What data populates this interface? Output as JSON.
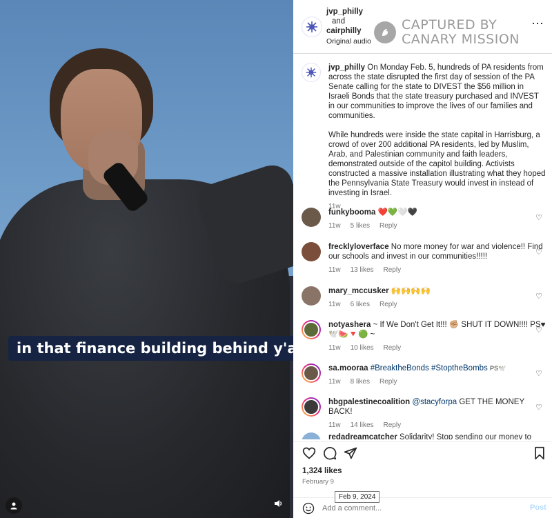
{
  "video": {
    "caption": "in that finance building behind y'all",
    "account_icon": "person-icon",
    "audio_icon": "speaker-icon"
  },
  "header": {
    "user1": "jvp_philly",
    "and": "and",
    "user2": "cairphilly",
    "audio": "Original audio",
    "watermark_line1": "CAPTURED BY",
    "watermark_line2": "CANARY MISSION",
    "more": "⋯"
  },
  "post": {
    "user": "jvp_philly",
    "text1": "On Monday Feb. 5, hundreds of PA residents from across the state disrupted the first day of session of the PA Senate calling for the state to DIVEST the $56 million in Israeli Bonds that the state treasury purchased and INVEST in our communities to improve the lives of our families and communities.",
    "text2": "While hundreds were inside the state capital in Harrisburg, a crowd of over 200 additional PA residents, led by Muslim, Arab, and Palestinian community and faith leaders, demonstrated outside of the capitol building. Activists constructed a massive installation illustrating what they hoped the Pennsylvania State Treasury would invest in instead of investing in Israel.",
    "time": "11w"
  },
  "comments": [
    {
      "user": "funkybooma",
      "text": "❤️💚🤍🖤",
      "tags": "",
      "time": "11w",
      "likes": "5 likes",
      "reply": "Reply",
      "avatar_color": "#6b5a4a"
    },
    {
      "user": "frecklyloverface",
      "text": "No more money for war and violence!! Find our schools and invest in our communities!!!!!",
      "tags": "",
      "time": "11w",
      "likes": "13 likes",
      "reply": "Reply",
      "avatar_color": "#7a4e3a"
    },
    {
      "user": "mary_mccusker",
      "text": "🙌🙌🙌🙌",
      "tags": "",
      "time": "11w",
      "likes": "6 likes",
      "reply": "Reply",
      "avatar_color": "#8a7468"
    },
    {
      "user": "notyashera",
      "text": "~ If We Don't Get It!!! ✊🏼 SHUT IT DOWN!!!! PS♥ 🕊️🍉🔻🟢 ~",
      "tags": "",
      "time": "11w",
      "likes": "10 likes",
      "reply": "Reply",
      "avatar_color": "#5d6b3a"
    },
    {
      "user": "sa.mooraa",
      "text": "PS🕊️",
      "tags": "#BreaktheBonds #StoptheBombs",
      "time": "11w",
      "likes": "8 likes",
      "reply": "Reply",
      "avatar_color": "#6a5848"
    },
    {
      "user": "hbgpalestinecoalition",
      "text": "GET THE MONEY BACK!",
      "tags": "@stacyforpa",
      "time": "11w",
      "likes": "14 likes",
      "reply": "Reply",
      "avatar_color": "#3b3b3b"
    },
    {
      "user": "redadreamcatcher",
      "text": "Solidarity! Stop sending our money to",
      "tags": "",
      "time": "",
      "likes": "",
      "reply": "",
      "avatar_color": "#8ab0d8"
    }
  ],
  "actions": {
    "like_icon": "heart-icon",
    "comment_icon": "comment-icon",
    "share_icon": "share-icon",
    "save_icon": "bookmark-icon",
    "likes": "1,324 likes",
    "date": "February 9",
    "tooltip": "Feb 9, 2024"
  },
  "comment_box": {
    "placeholder": "Add a comment...",
    "post_label": "Post",
    "emoji_icon": "smiley-icon"
  },
  "colors": {
    "link": "#00376b",
    "post_button": "#b3dbff",
    "caption_bg": "#162342",
    "watermark": "#9a9a9a"
  }
}
